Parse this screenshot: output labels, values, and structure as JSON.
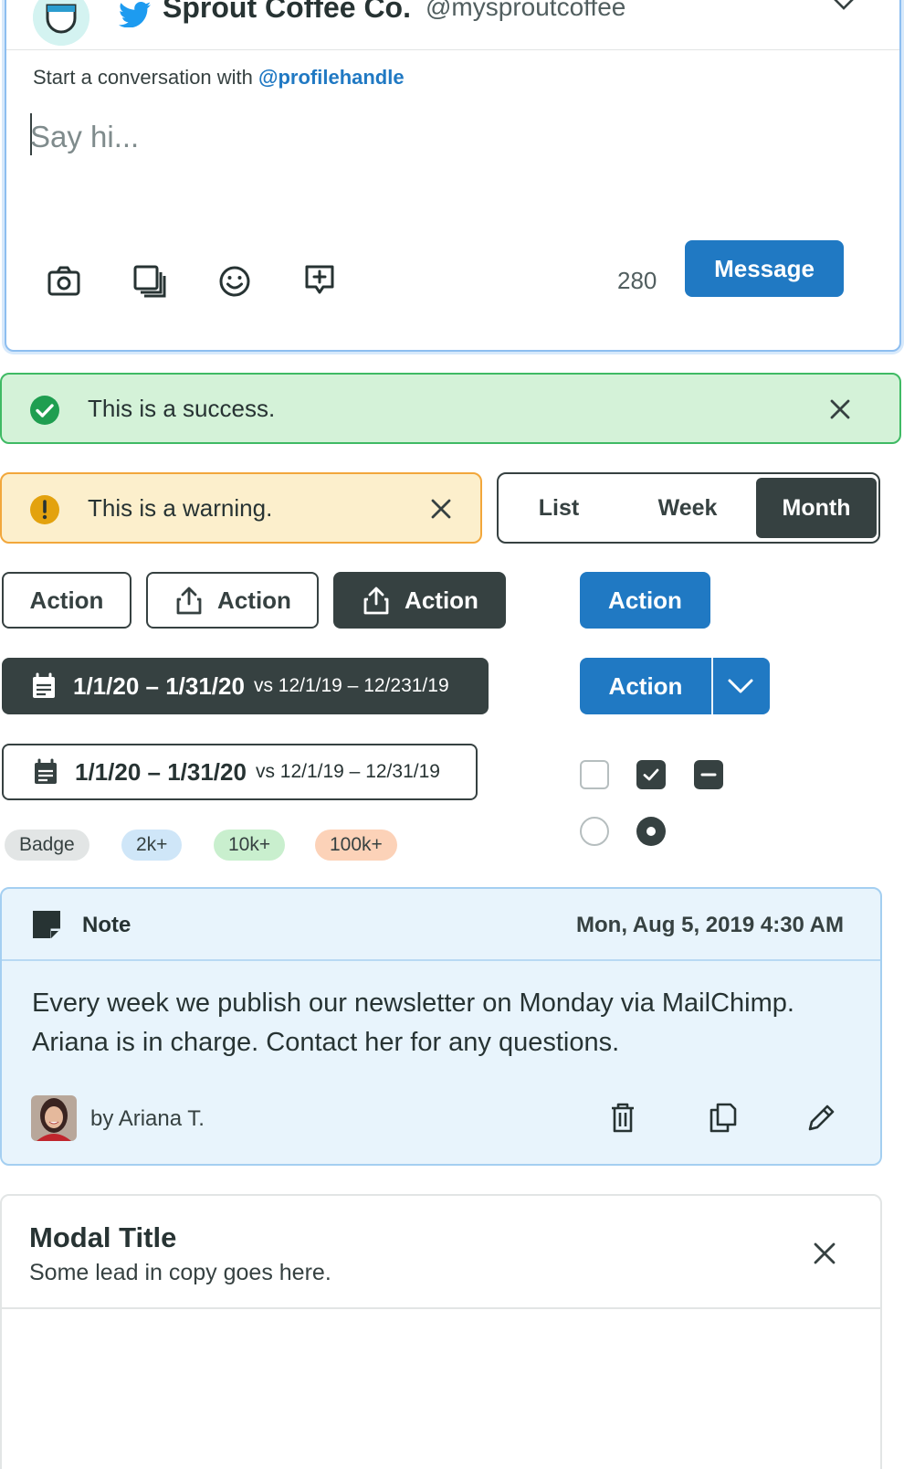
{
  "composer": {
    "profile_name": "Sprout Coffee Co.",
    "profile_handle": "@mysproutcoffee",
    "convo_prefix": "Start a conversation with ",
    "convo_handle": "@profilehandle",
    "input_placeholder": "Say hi...",
    "input_value": "",
    "char_count": "280",
    "message_label": "Message",
    "toolbar_icons": [
      "camera-icon",
      "media-library-icon",
      "emoji-icon",
      "saved-reply-icon"
    ]
  },
  "alerts": {
    "success": "This is a success.",
    "warning": "This is a warning."
  },
  "segmented": {
    "options": [
      "List",
      "Week",
      "Month"
    ],
    "selected": "Month"
  },
  "buttons": {
    "outline_action": "Action",
    "outline_icon_action": "Action",
    "dark_icon_action": "Action",
    "primary_action": "Action",
    "split_action": "Action"
  },
  "date_ranges": {
    "dark": {
      "main": "1/1/20 – 1/31/20",
      "vs": "vs 12/1/19 – 12/231/19"
    },
    "light": {
      "main": "1/1/20 – 1/31/20",
      "vs": "vs 12/1/19 – 12/31/19"
    }
  },
  "controls": {
    "checkboxes": [
      "unchecked",
      "checked",
      "indeterminate"
    ],
    "radios": [
      "unselected",
      "selected"
    ]
  },
  "badges": [
    {
      "label": "Badge",
      "color": "#e2e5e5"
    },
    {
      "label": "2k+",
      "color": "#cfe6f8"
    },
    {
      "label": "10k+",
      "color": "#c9efce"
    },
    {
      "label": "100k+",
      "color": "#fcd2b8"
    }
  ],
  "note": {
    "label": "Note",
    "date": "Mon, Aug 5, 2019 4:30 AM",
    "body": "Every week we publish our newsletter on Monday via MailChimp. Ariana is in charge. Contact her for any questions.",
    "author": "by Ariana T."
  },
  "modal": {
    "title": "Modal Title",
    "lead": "Some lead in copy goes here."
  },
  "colors": {
    "primary": "#2079c3",
    "dark": "#364141",
    "success_bg": "#d4f2d8",
    "success_border": "#3fba64",
    "warning_bg": "#fcefcc",
    "warning_border": "#f2a73b",
    "note_bg": "#e8f4fc"
  }
}
